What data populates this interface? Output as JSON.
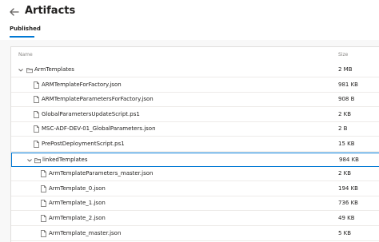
{
  "header": {
    "title": "Artifacts",
    "back_icon": "arrow-left-icon",
    "tabs": [
      {
        "label": "Published",
        "selected": true
      }
    ]
  },
  "table": {
    "columns": {
      "name": "Name",
      "size": "Size"
    },
    "rows": [
      {
        "name": "ArmTemplates",
        "size": "2 MB",
        "kind": "folder-expanded",
        "depth": 0
      },
      {
        "name": "ARMTemplateForFactory.json",
        "size": "981 KB",
        "kind": "file",
        "depth": 1
      },
      {
        "name": "ARMTemplateParametersForFactory.json",
        "size": "908 B",
        "kind": "file",
        "depth": 1
      },
      {
        "name": "GlobalParametersUpdateScript.ps1",
        "size": "2 KB",
        "kind": "file",
        "depth": 1
      },
      {
        "name": "MSC-ADF-DEV-01_GlobalParameters.json",
        "size": "2 B",
        "kind": "file",
        "depth": 1
      },
      {
        "name": "PrePostDeploymentScript.ps1",
        "size": "15 KB",
        "kind": "file",
        "depth": 1
      },
      {
        "name": "linkedTemplates",
        "size": "984 KB",
        "kind": "folder-expanded",
        "depth": 1,
        "selected": true
      },
      {
        "name": "ArmTemplateParameters_master.json",
        "size": "2 KB",
        "kind": "file",
        "depth": 2
      },
      {
        "name": "ArmTemplate_0.json",
        "size": "194 KB",
        "kind": "file",
        "depth": 2
      },
      {
        "name": "ArmTemplate_1.json",
        "size": "736 KB",
        "kind": "file",
        "depth": 2
      },
      {
        "name": "ArmTemplate_2.json",
        "size": "49 KB",
        "kind": "file",
        "depth": 2
      },
      {
        "name": "ArmTemplate_master.json",
        "size": "5 KB",
        "kind": "file",
        "depth": 2
      }
    ]
  },
  "colors": {
    "accent": "#0078d4",
    "text": "#201f1e",
    "muted": "#8a8886",
    "border": "#edebe9"
  }
}
